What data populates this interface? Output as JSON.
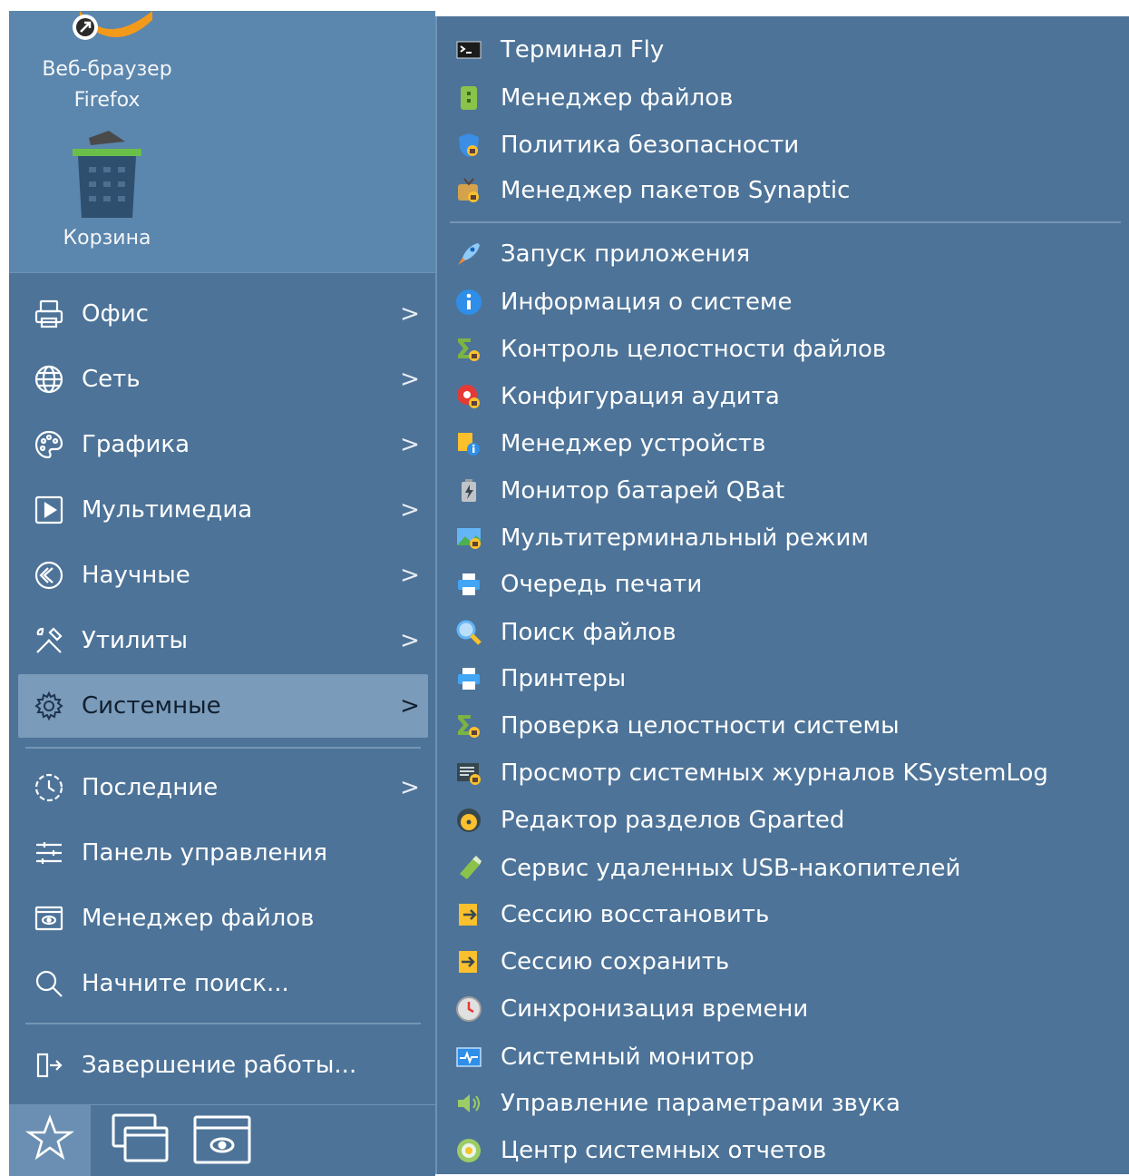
{
  "desktop": {
    "icons": [
      {
        "label_line1": "Веб-браузер",
        "label_line2": "Firefox",
        "icon": "firefox-icon"
      },
      {
        "label": "Корзина",
        "icon": "trash-icon"
      }
    ]
  },
  "menu": {
    "categories": [
      {
        "label": "Офис",
        "icon": "printer-icon",
        "arrow": ">"
      },
      {
        "label": "Сеть",
        "icon": "globe-icon",
        "arrow": ">"
      },
      {
        "label": "Графика",
        "icon": "palette-icon",
        "arrow": ">"
      },
      {
        "label": "Мультимедиа",
        "icon": "play-icon",
        "arrow": ">"
      },
      {
        "label": "Научные",
        "icon": "science-icon",
        "arrow": ">"
      },
      {
        "label": "Утилиты",
        "icon": "tools-icon",
        "arrow": ">"
      },
      {
        "label": "Системные",
        "icon": "gear-icon",
        "arrow": ">",
        "selected": true
      }
    ],
    "extras": [
      {
        "label": "Последние",
        "icon": "recent-icon",
        "arrow": ">"
      },
      {
        "label": "Панель управления",
        "icon": "sliders-icon"
      },
      {
        "label": "Менеджер файлов",
        "icon": "file-manager-icon"
      },
      {
        "label": "Начните поиск...",
        "icon": "search-icon"
      }
    ],
    "shutdown": {
      "label": "Завершение работы...",
      "icon": "logout-icon"
    },
    "bottom_bar": [
      {
        "icon": "star-icon",
        "active": true
      },
      {
        "icon": "windows-icon"
      },
      {
        "icon": "folder-eye-icon"
      }
    ]
  },
  "submenu": {
    "group1": [
      {
        "label": "Терминал Fly",
        "icon": "terminal-icon",
        "color": "#1b1b1b"
      },
      {
        "label": "Менеджер файлов",
        "icon": "file-manager-app-icon",
        "color": "#8bc34a"
      },
      {
        "label": "Политика безопасности",
        "icon": "security-policy-icon",
        "color": "#3a8ee6"
      },
      {
        "label": "Менеджер пакетов Synaptic",
        "icon": "synaptic-icon",
        "color": "#e6a23c"
      }
    ],
    "group2": [
      {
        "label": "Запуск приложения",
        "icon": "rocket-icon",
        "color": "#f08a3c"
      },
      {
        "label": "Информация о системе",
        "icon": "info-icon",
        "color": "#2f8ee8"
      },
      {
        "label": "Контроль целостности файлов",
        "icon": "file-integrity-icon",
        "color": "#7cb342"
      },
      {
        "label": "Конфигурация аудита",
        "icon": "audit-config-icon",
        "color": "#e53935"
      },
      {
        "label": "Менеджер устройств",
        "icon": "device-manager-icon",
        "color": "#fbc02d"
      },
      {
        "label": "Монитор батарей QBat",
        "icon": "battery-icon",
        "color": "#c0c4c8"
      },
      {
        "label": "Мультитерминальный режим",
        "icon": "multiterminal-icon",
        "color": "#4caf50"
      },
      {
        "label": "Очередь печати",
        "icon": "print-queue-icon",
        "color": "#42a5f5"
      },
      {
        "label": "Поиск файлов",
        "icon": "file-search-icon",
        "color": "#64b5f6"
      },
      {
        "label": "Принтеры",
        "icon": "printers-icon",
        "color": "#42a5f5"
      },
      {
        "label": "Проверка целостности системы",
        "icon": "system-integrity-icon",
        "color": "#7cb342"
      },
      {
        "label": "Просмотр системных журналов KSystemLog",
        "icon": "log-viewer-icon",
        "color": "#37474f"
      },
      {
        "label": "Редактор разделов Gparted",
        "icon": "gparted-icon",
        "color": "#fbc02d"
      },
      {
        "label": "Сервис удаленных USB-накопителей",
        "icon": "usb-icon",
        "color": "#8bc34a"
      },
      {
        "label": "Сессию восстановить",
        "icon": "session-restore-icon",
        "color": "#fbc02d"
      },
      {
        "label": "Сессию сохранить",
        "icon": "session-save-icon",
        "color": "#fbc02d"
      },
      {
        "label": "Синхронизация времени",
        "icon": "time-sync-icon",
        "color": "#e0e0e0"
      },
      {
        "label": "Системный монитор",
        "icon": "system-monitor-icon",
        "color": "#2f8ee8"
      },
      {
        "label": "Управление параметрами звука",
        "icon": "sound-icon",
        "color": "#9ccc65"
      },
      {
        "label": "Центр системных отчетов",
        "icon": "reports-center-icon",
        "color": "#9ccc65"
      }
    ]
  }
}
